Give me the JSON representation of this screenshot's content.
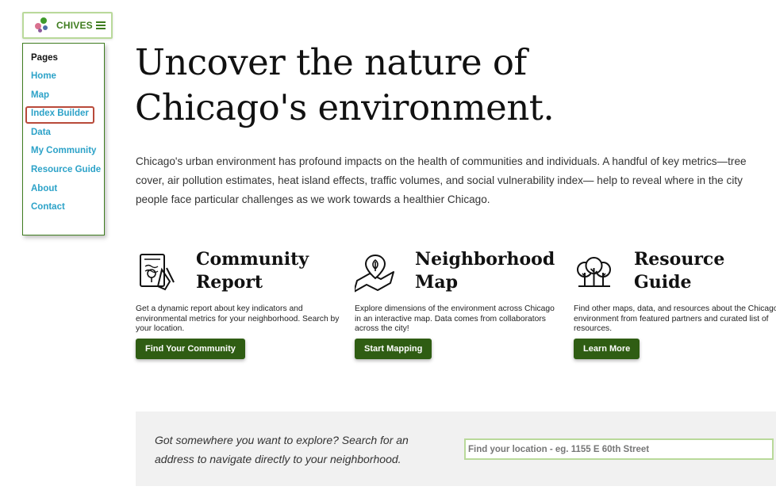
{
  "logo": {
    "name": "CHIVES",
    "menu_icon": "hamburger-icon",
    "mark_icon": "chives-logo-icon"
  },
  "pages_menu": {
    "title": "Pages",
    "items": [
      {
        "label": "Home"
      },
      {
        "label": "Map"
      },
      {
        "label": "Index Builder",
        "highlighted": true
      },
      {
        "label": "Data"
      },
      {
        "label": "My Community"
      },
      {
        "label": "Resource Guide"
      },
      {
        "label": "About"
      },
      {
        "label": "Contact"
      }
    ]
  },
  "hero": {
    "title_line1": "Uncover the nature of",
    "title_line2": "Chicago's environment.",
    "description": "Chicago's urban environment has profound impacts on the health of communities and individuals. A handful of key metrics—tree cover, air pollution estimates, heat island effects, traffic volumes, and social vulnerability index— help to reveal where in the city people face particular challenges as we work towards a healthier Chicago."
  },
  "cards": [
    {
      "icon": "community-report-icon",
      "title_line1": "Community",
      "title_line2": "Report",
      "description": "Get a dynamic report about key indicators and environmental metrics for your neighborhood. Search by your location.",
      "button": "Find Your Community"
    },
    {
      "icon": "neighborhood-map-icon",
      "title_line1": "Neighborhood",
      "title_line2": "Map",
      "description": "Explore dimensions of the environment across Chicago in an interactive map. Data comes from collaborators across the city!",
      "button": "Start Mapping"
    },
    {
      "icon": "resource-guide-icon",
      "title_line1": "Resource",
      "title_line2": "Guide",
      "description": "Find other maps, data, and resources about the Chicago environment from featured partners and curated list of resources.",
      "button": "Learn More"
    }
  ],
  "search": {
    "prompt": "Got somewhere you want to explore? Search for an address to navigate directly to your neighborhood.",
    "placeholder": "Find your location - eg. 1155 E 60th Street",
    "value": ""
  },
  "colors": {
    "brand_green": "#3f7d20",
    "button_green": "#2f5d13",
    "link_blue": "#2ca2c8",
    "highlight_red": "#b84a3a",
    "input_border": "#b9d99a"
  }
}
